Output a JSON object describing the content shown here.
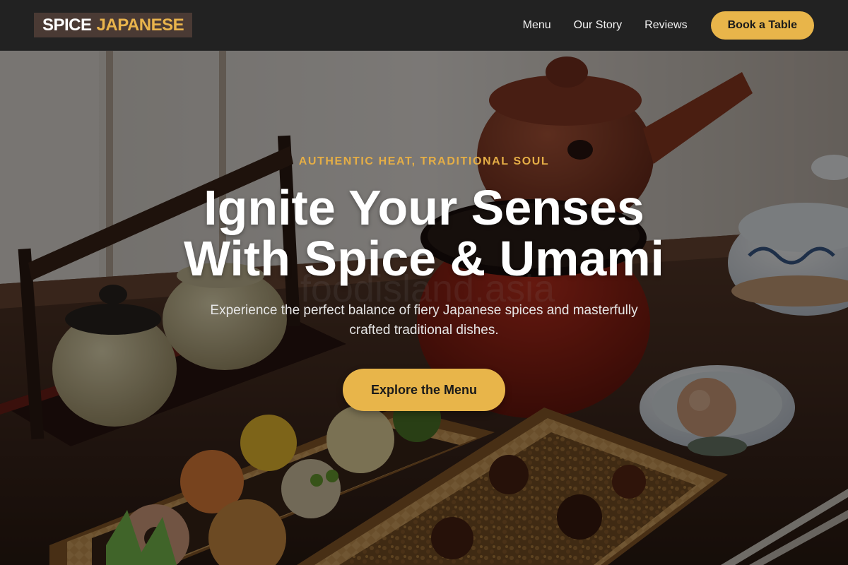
{
  "brand": {
    "word1": "SPICE",
    "word2": "JAPANESE"
  },
  "nav": {
    "links": [
      "Menu",
      "Our Story",
      "Reviews"
    ],
    "cta": "Book a Table"
  },
  "hero": {
    "eyebrow": "AUTHENTIC HEAT, TRADITIONAL SOUL",
    "headline_line1": "Ignite Your Senses",
    "headline_line2": "With Spice & Umami",
    "subtitle": "Experience the perfect balance of fiery Japanese spices and masterfully crafted traditional dishes.",
    "cta": "Explore the Menu",
    "background_image": "japanese-bento-table-photo"
  },
  "colors": {
    "accent": "#e8b54a",
    "nav_bg": "#222222",
    "logo_bg": "#4a3a34"
  }
}
